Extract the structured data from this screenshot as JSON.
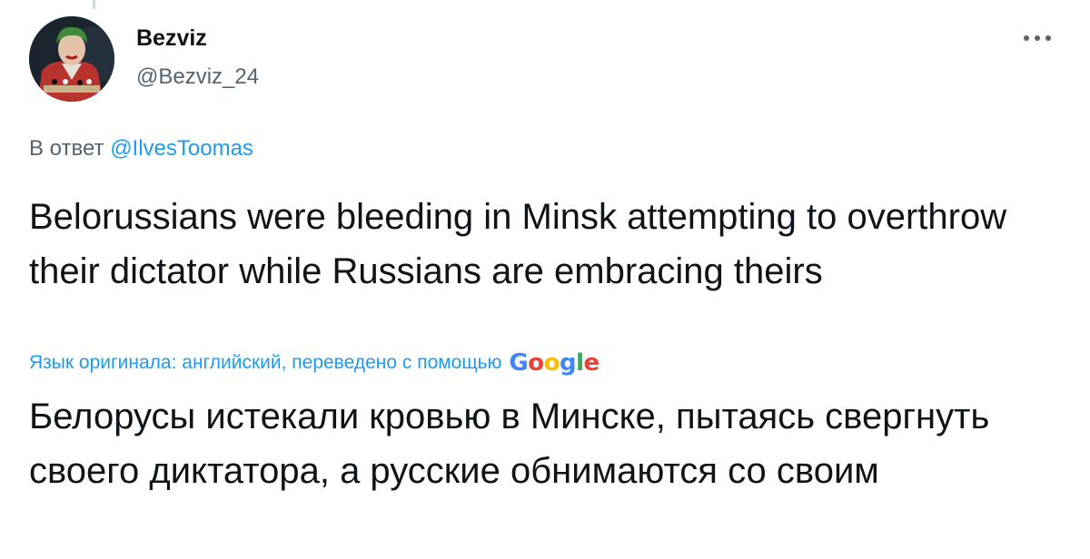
{
  "author": {
    "name": "Bezviz",
    "handle": "@Bezviz_24"
  },
  "reply": {
    "prefix": "В ответ",
    "handle": "@IlvesToomas"
  },
  "tweet": {
    "text": "Belorussians were bleeding in Minsk attempting to overthrow their dictator while Russians are embracing theirs"
  },
  "translation": {
    "note": "Язык оригинала: английский, переведено с помощью",
    "provider_logo_letters": [
      "G",
      "o",
      "o",
      "g",
      "l",
      "e"
    ],
    "text": "Белорусы истекали кровью в Минске, пытаясь свергнуть своего диктатора, а русские обнимаются со своим"
  },
  "icons": {
    "more": "more-horizontal-icon"
  },
  "colors": {
    "link": "#1d9bf0",
    "secondary_text": "#536471",
    "primary_text": "#0f1419"
  }
}
